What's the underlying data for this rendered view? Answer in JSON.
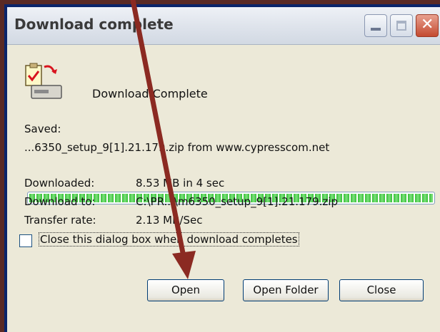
{
  "window": {
    "title": "Download complete"
  },
  "header": {
    "message": "Download Complete",
    "icon": "download-complete-icon"
  },
  "details": {
    "saved_label": "Saved:",
    "saved_value": "...6350_setup_9[1].21.179.zip from www.cypresscom.net",
    "progress": 1.0,
    "rows": [
      {
        "label": "Downloaded:",
        "value": "8.53 MB in 4 sec"
      },
      {
        "label": "Download to:",
        "value": "C:\\PR...\\m6350_setup_9[1].21.179.zip"
      },
      {
        "label": "Transfer rate:",
        "value": "2.13 MB/Sec"
      }
    ]
  },
  "checkbox": {
    "label": "Close this dialog box when download completes",
    "checked": false
  },
  "buttons": {
    "open": "Open",
    "open_folder": "Open Folder",
    "close": "Close"
  },
  "colors": {
    "progress_green": "#35c035",
    "arrow": "#8b2a22",
    "window_bg": "#ece9d8"
  }
}
